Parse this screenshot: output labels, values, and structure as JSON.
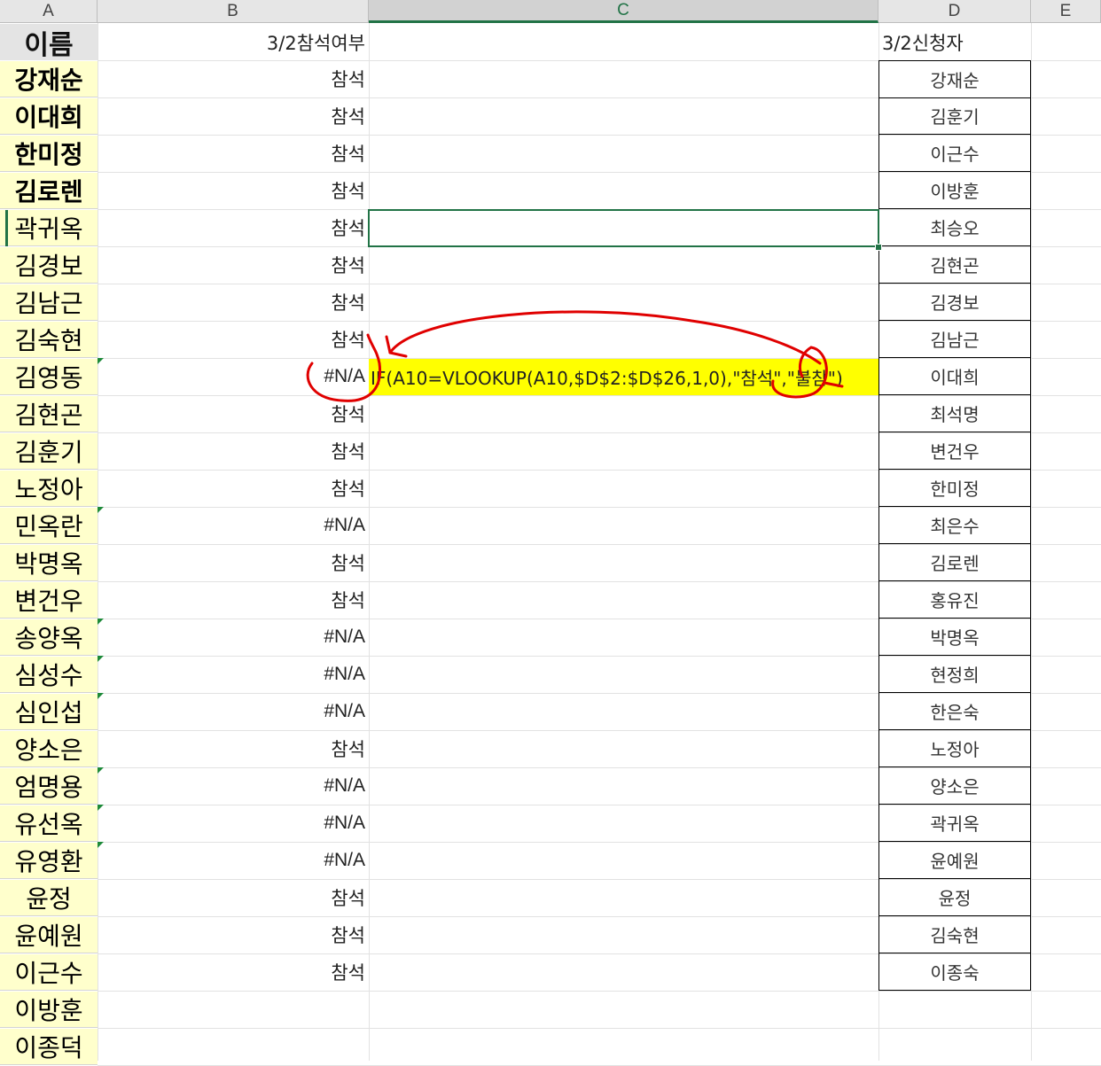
{
  "columns": [
    "A",
    "B",
    "C",
    "D",
    "E"
  ],
  "selected_column": "C",
  "header_row": {
    "a": "이름",
    "b": "3/2참석여부",
    "d": "3/2신청자"
  },
  "names": [
    "강재순",
    "이대희",
    "한미정",
    "김로렌",
    "곽귀옥",
    "김경보",
    "김남근",
    "김숙현",
    "김영동",
    "김현곤",
    "김훈기",
    "노정아",
    "민옥란",
    "박명옥",
    "변건우",
    "송양옥",
    "심성수",
    "심인섭",
    "양소은",
    "엄명용",
    "유선옥",
    "유영환",
    "윤정",
    "윤예원",
    "이근수",
    "이방훈",
    "이종덕"
  ],
  "status": [
    "참석",
    "참석",
    "참석",
    "참석",
    "참석",
    "참석",
    "참석",
    "참석",
    "#N/A",
    "참석",
    "참석",
    "참석",
    "#N/A",
    "참석",
    "참석",
    "#N/A",
    "#N/A",
    "#N/A",
    "참석",
    "#N/A",
    "#N/A",
    "#N/A",
    "참석",
    "참석",
    "참석",
    "",
    ""
  ],
  "applicants": [
    "강재순",
    "김훈기",
    "이근수",
    "이방훈",
    "최승오",
    "김현곤",
    "김경보",
    "김남근",
    "이대희",
    "최석명",
    "변건우",
    "한미정",
    "최은수",
    "김로렌",
    "홍유진",
    "박명옥",
    "현정희",
    "한은숙",
    "노정아",
    "양소은",
    "곽귀옥",
    "윤예원",
    "윤정",
    "김숙현",
    "이종숙"
  ],
  "formula_text": "IF(A10=VLOOKUP(A10,$D$2:$D$26,1,0),\"참석\",\"불참\")",
  "colors": {
    "highlight": "#ffff00",
    "name_fill": "#ffffcc",
    "annotation": "#e00000",
    "selection": "#217346"
  }
}
